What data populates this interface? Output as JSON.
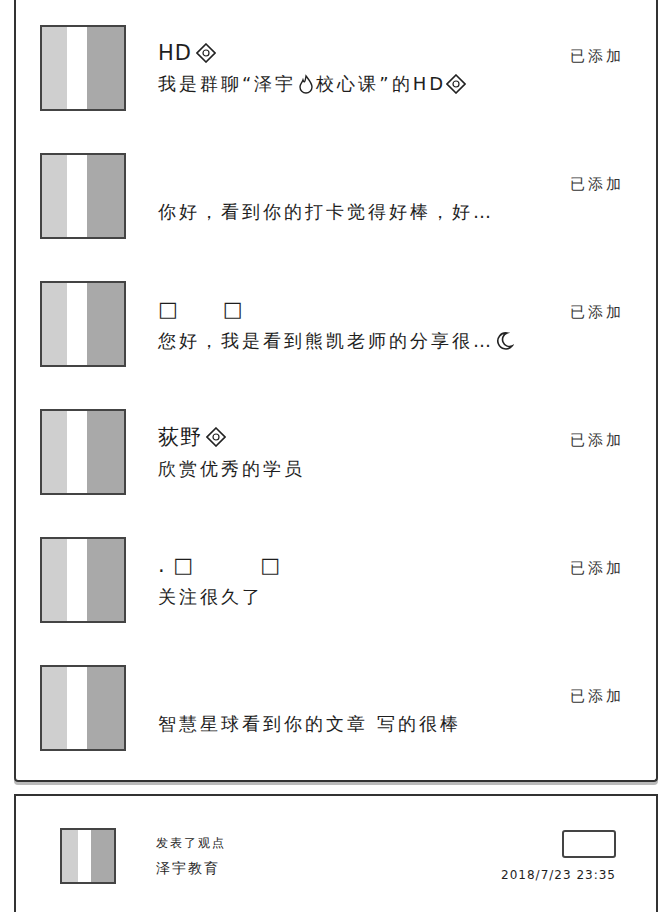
{
  "requests": [
    {
      "name": "HD",
      "nameBadge": true,
      "message": [
        {
          "kind": "text",
          "text": "我是群聊“泽宇"
        },
        {
          "kind": "flame"
        },
        {
          "kind": "text",
          "text": "校心课”的HD"
        },
        {
          "kind": "badge"
        }
      ],
      "status": "已添加"
    },
    {
      "name": "",
      "nameBadge": false,
      "message": [
        {
          "kind": "text",
          "text": "你好，看到你的打卡觉得好棒，好…"
        }
      ],
      "status": "已添加"
    },
    {
      "name": "□　　□",
      "nameBadge": false,
      "message": [
        {
          "kind": "text",
          "text": "您好，我是看到熊凯老师的分享很…"
        },
        {
          "kind": "moon"
        }
      ],
      "status": "已添加"
    },
    {
      "name": "荻野",
      "nameBadge": true,
      "message": [
        {
          "kind": "text",
          "text": "欣赏优秀的学员"
        }
      ],
      "status": "已添加"
    },
    {
      "name": ". □　　　□",
      "nameBadge": false,
      "message": [
        {
          "kind": "text",
          "text": "关注很久了"
        }
      ],
      "status": "已添加"
    },
    {
      "name": "",
      "nameBadge": false,
      "message": [
        {
          "kind": "text",
          "text": "智慧星球看到你的文章 写的很棒"
        }
      ],
      "status": "已添加"
    }
  ],
  "post": {
    "action": "发表了观点",
    "author": "泽宇教育",
    "time": "2018/7/23 23:35"
  }
}
